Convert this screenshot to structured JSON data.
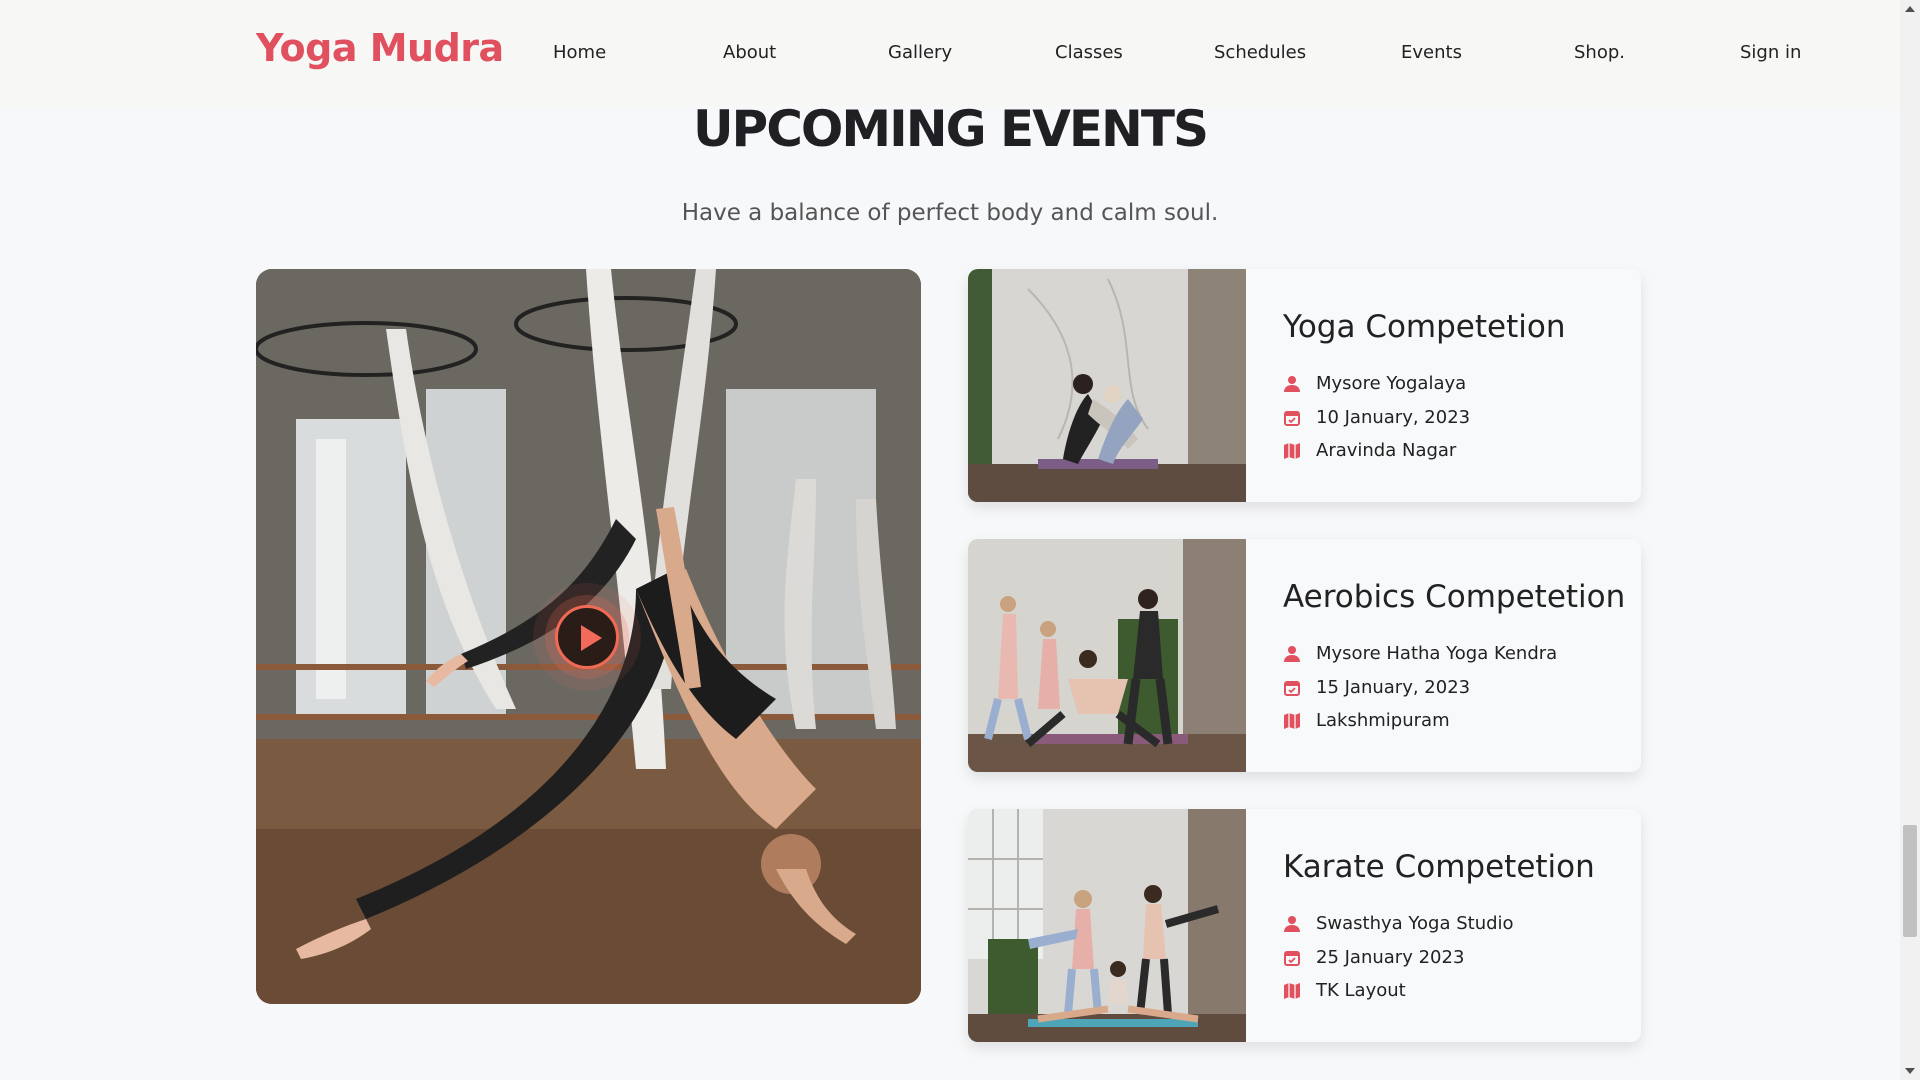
{
  "header": {
    "logo": "Yoga Mudra",
    "nav": [
      "Home",
      "About",
      "Gallery",
      "Classes",
      "Schedules",
      "Events",
      "Shop.",
      "Sign in"
    ]
  },
  "section": {
    "title": "UPCOMING EVENTS",
    "subtitle": "Have a balance of perfect body and calm soul."
  },
  "events": [
    {
      "title": "Yoga Competetion",
      "organizer": "Mysore Yogalaya",
      "date": "10 January, 2023",
      "location": "Aravinda Nagar"
    },
    {
      "title": "Aerobics Competetion",
      "organizer": "Mysore Hatha Yoga Kendra",
      "date": "15 January, 2023",
      "location": "Lakshmipuram"
    },
    {
      "title": "Karate Competetion",
      "organizer": "Swasthya Yoga Studio",
      "date": "25 January 2023",
      "location": "TK Layout"
    }
  ],
  "icons": {
    "organizer": "person-icon",
    "date": "calendar-icon",
    "location": "map-icon"
  },
  "colors": {
    "brand": "#e0505e",
    "play_accent": "#f06a55"
  }
}
